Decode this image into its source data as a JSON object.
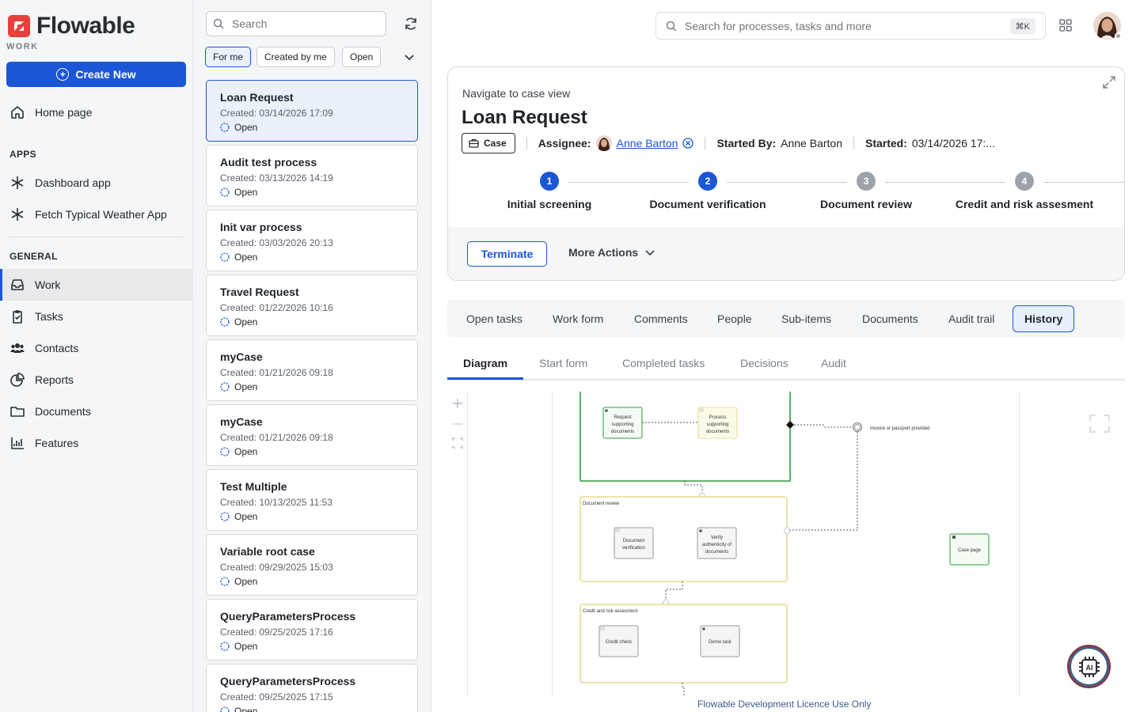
{
  "brand": {
    "name": "Flowable",
    "sub": "WORK"
  },
  "sidebar": {
    "create_label": "Create New",
    "home_label": "Home page",
    "apps_label": "APPS",
    "apps": [
      "Dashboard app",
      "Fetch Typical Weather App"
    ],
    "general_label": "GENERAL",
    "general": [
      "Work",
      "Tasks",
      "Contacts",
      "Reports",
      "Documents",
      "Features"
    ]
  },
  "list": {
    "search_placeholder": "Search",
    "filters": [
      "For me",
      "Created by me",
      "Open"
    ],
    "items": [
      {
        "title": "Loan Request",
        "created": "Created: 03/14/2026 17:09",
        "status": "Open"
      },
      {
        "title": "Audit test process",
        "created": "Created: 03/13/2026 14:19",
        "status": "Open"
      },
      {
        "title": "Init var process",
        "created": "Created: 03/03/2026 20:13",
        "status": "Open"
      },
      {
        "title": "Travel Request",
        "created": "Created: 01/22/2026 10:16",
        "status": "Open"
      },
      {
        "title": "myCase",
        "created": "Created: 01/21/2026 09:18",
        "status": "Open"
      },
      {
        "title": "myCase",
        "created": "Created: 01/21/2026 09:18",
        "status": "Open"
      },
      {
        "title": "Test Multiple",
        "created": "Created: 10/13/2025 11:53",
        "status": "Open"
      },
      {
        "title": "Variable root case",
        "created": "Created: 09/29/2025 15:03",
        "status": "Open"
      },
      {
        "title": "QueryParametersProcess",
        "created": "Created: 09/25/2025 17:16",
        "status": "Open"
      },
      {
        "title": "QueryParametersProcess",
        "created": "Created: 09/25/2025 17:15",
        "status": "Open"
      }
    ]
  },
  "topbar": {
    "search_placeholder": "Search for processes, tasks and more",
    "shortcut": "⌘K"
  },
  "case": {
    "nav_link": "Navigate to case view",
    "title": "Loan Request",
    "type_chip": "Case",
    "assignee_label": "Assignee:",
    "assignee": "Anne Barton",
    "started_by_label": "Started By:",
    "started_by": "Anne Barton",
    "started_label": "Started:",
    "started": "03/14/2026 17:...",
    "stages": [
      {
        "num": "1",
        "label": "Initial screening",
        "state": "active"
      },
      {
        "num": "2",
        "label": "Document verification",
        "state": "active"
      },
      {
        "num": "3",
        "label": "Document review",
        "state": "pending"
      },
      {
        "num": "4",
        "label": "Credit and risk assesment",
        "state": "pending"
      }
    ],
    "terminate_label": "Terminate",
    "more_actions_label": "More Actions"
  },
  "tabs": [
    "Open tasks",
    "Work form",
    "Comments",
    "People",
    "Sub-items",
    "Documents",
    "Audit trail",
    "History"
  ],
  "subtabs": [
    "Diagram",
    "Start form",
    "Completed tasks",
    "Decisions",
    "Audit"
  ],
  "diagram": {
    "tasks": {
      "request_docs": "Request supporting documents",
      "process_docs": "Process supporting documents",
      "doc_verification": "Document verification",
      "verify_auth": "Verify authenticity of documents",
      "credit_check": "Credit check",
      "demo_task": "Demo task",
      "case_page": "Case page"
    },
    "stages": {
      "doc_review": "Document review",
      "credit_risk": "Credit and risk assesment"
    },
    "criterion_label": "Invoice or passport provided"
  },
  "licence": "Flowable Development Licence Use Only",
  "colors": {
    "accent": "#1b56d6",
    "stage_active": "#2e9e3a",
    "stage_pending": "#e6dc8a"
  }
}
